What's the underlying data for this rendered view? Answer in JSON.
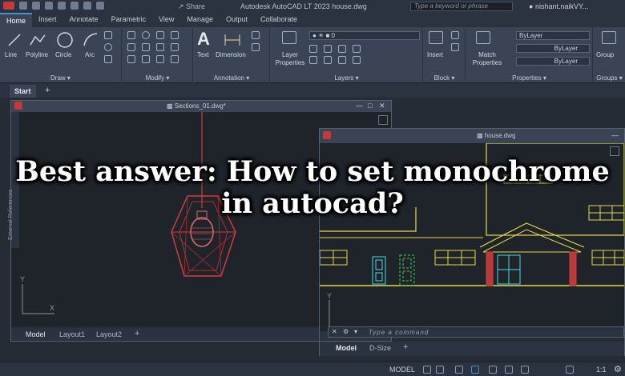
{
  "titlebar": {
    "share_label": "Share",
    "app_title": "Autodesk AutoCAD LT 2023    house.dwg",
    "search_placeholder": "Type a keyword or phrase",
    "user_name": "nishant.naikVY..."
  },
  "ribbon_tabs": [
    "Home",
    "Insert",
    "Annotate",
    "Parametric",
    "View",
    "Manage",
    "Output",
    "Collaborate"
  ],
  "ribbon": {
    "draw": {
      "title": "Draw",
      "tools": [
        "Line",
        "Polyline",
        "Circle",
        "Arc"
      ]
    },
    "modify": {
      "title": "Modify"
    },
    "annotation": {
      "title": "Annotation",
      "tools": [
        "Text",
        "Dimension"
      ]
    },
    "layers": {
      "title": "Layers",
      "layer_properties": "Layer Properties",
      "current_layer": "0"
    },
    "block": {
      "title": "Block",
      "insert": "Insert"
    },
    "properties": {
      "title": "Properties",
      "match_properties": "Match Properties",
      "color": "ByLayer",
      "linetype": "ByLayer",
      "lineweight": "ByLayer"
    },
    "groups": {
      "title": "Groups",
      "group": "Group"
    }
  },
  "file_tabs": {
    "start": "Start"
  },
  "left_window": {
    "title": "Sections_01.dwg*",
    "side_palette": "External References",
    "layout_tabs": [
      "Model",
      "Layout1",
      "Layout2"
    ]
  },
  "right_window": {
    "title": "house.dwg",
    "command_placeholder": "Type a command",
    "layout_tabs": [
      "Model",
      "D-Size"
    ]
  },
  "status": {
    "model": "MODEL",
    "scale": "1:1"
  },
  "overlay": {
    "headline": "Best answer: How to set monochrome in autocad?"
  },
  "colors": {
    "accent": "#4a8fd8",
    "lamp": "#d23b3b",
    "cad_yellow": "#e6d84a",
    "cad_cyan": "#4ad8e6",
    "cad_green": "#3fd34a"
  }
}
